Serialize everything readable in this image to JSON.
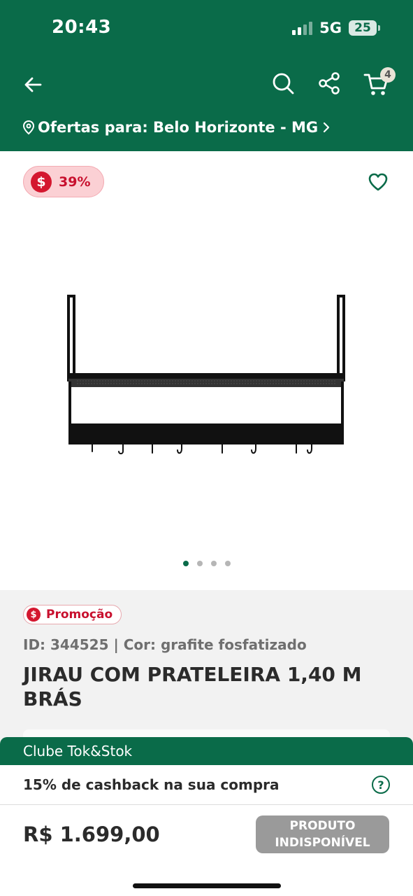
{
  "status_bar": {
    "time": "20:43",
    "network": "5G",
    "battery": "25"
  },
  "header": {
    "icons": [
      "back-arrow-icon",
      "search-icon",
      "share-icon",
      "cart-icon"
    ],
    "cart_count": "4",
    "location_text": "Ofertas para: Belo Horizonte - MG"
  },
  "gallery": {
    "discount": "39%",
    "discount_icon": "dollar-icon",
    "image_count": 4,
    "active_image": 1
  },
  "product": {
    "promo_label": "Promoção",
    "id_line": "ID: 344525 | Cor: grafite fosfatizado",
    "title": "JIRAU COM PRATELEIRA 1,40 M BRÁS"
  },
  "clube": {
    "title": "Clube Tok&Stok",
    "cashback_text": "15% de cashback na sua compra"
  },
  "purchase": {
    "price": "R$ 1.699,00",
    "button_label": "PRODUTO INDISPONÍVEL"
  },
  "colors": {
    "brand_green": "#0a6b49",
    "promo_red": "#c8102e",
    "disabled_gray": "#9a9a9a"
  }
}
